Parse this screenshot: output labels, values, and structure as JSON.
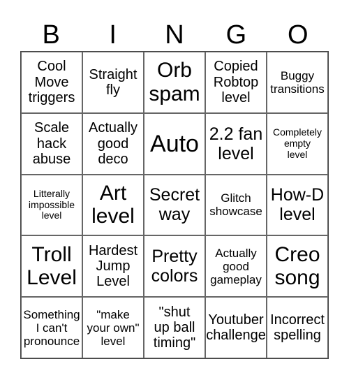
{
  "header": {
    "letters": [
      "B",
      "I",
      "N",
      "G",
      "O"
    ]
  },
  "cells": [
    {
      "text": "Cool\nMove\ntriggers",
      "size": "md"
    },
    {
      "text": "Straight\nfly",
      "size": "md"
    },
    {
      "text": "Orb\nspam",
      "size": "xl"
    },
    {
      "text": "Copied\nRobtop\nlevel",
      "size": "md"
    },
    {
      "text": "Buggy\ntransitions",
      "size": "sm"
    },
    {
      "text": "Scale\nhack\nabuse",
      "size": "md"
    },
    {
      "text": "Actually\ngood\ndeco",
      "size": "md"
    },
    {
      "text": "Auto",
      "size": "xxl"
    },
    {
      "text": "2.2 fan\nlevel",
      "size": "lg"
    },
    {
      "text": "Completely\nempty\nlevel",
      "size": "xs"
    },
    {
      "text": "Litterally\nimpossible\nlevel",
      "size": "xs"
    },
    {
      "text": "Art\nlevel",
      "size": "xl"
    },
    {
      "text": "Secret\nway",
      "size": "lg"
    },
    {
      "text": "Glitch\nshowcase",
      "size": "sm"
    },
    {
      "text": "How-D\nlevel",
      "size": "lg"
    },
    {
      "text": "Troll\nLevel",
      "size": "xl"
    },
    {
      "text": "Hardest\nJump\nLevel",
      "size": "md"
    },
    {
      "text": "Pretty\ncolors",
      "size": "lg"
    },
    {
      "text": "Actually\ngood\ngameplay",
      "size": "sm"
    },
    {
      "text": "Creo\nsong",
      "size": "xl"
    },
    {
      "text": "Something\nI can't\npronounce",
      "size": "sm"
    },
    {
      "text": "\"make\nyour own\"\nlevel",
      "size": "sm"
    },
    {
      "text": "\"shut\nup ball\ntiming\"",
      "size": "md"
    },
    {
      "text": "Youtuber\nchallenge",
      "size": "md"
    },
    {
      "text": "Incorrect\nspelling",
      "size": "md"
    }
  ]
}
